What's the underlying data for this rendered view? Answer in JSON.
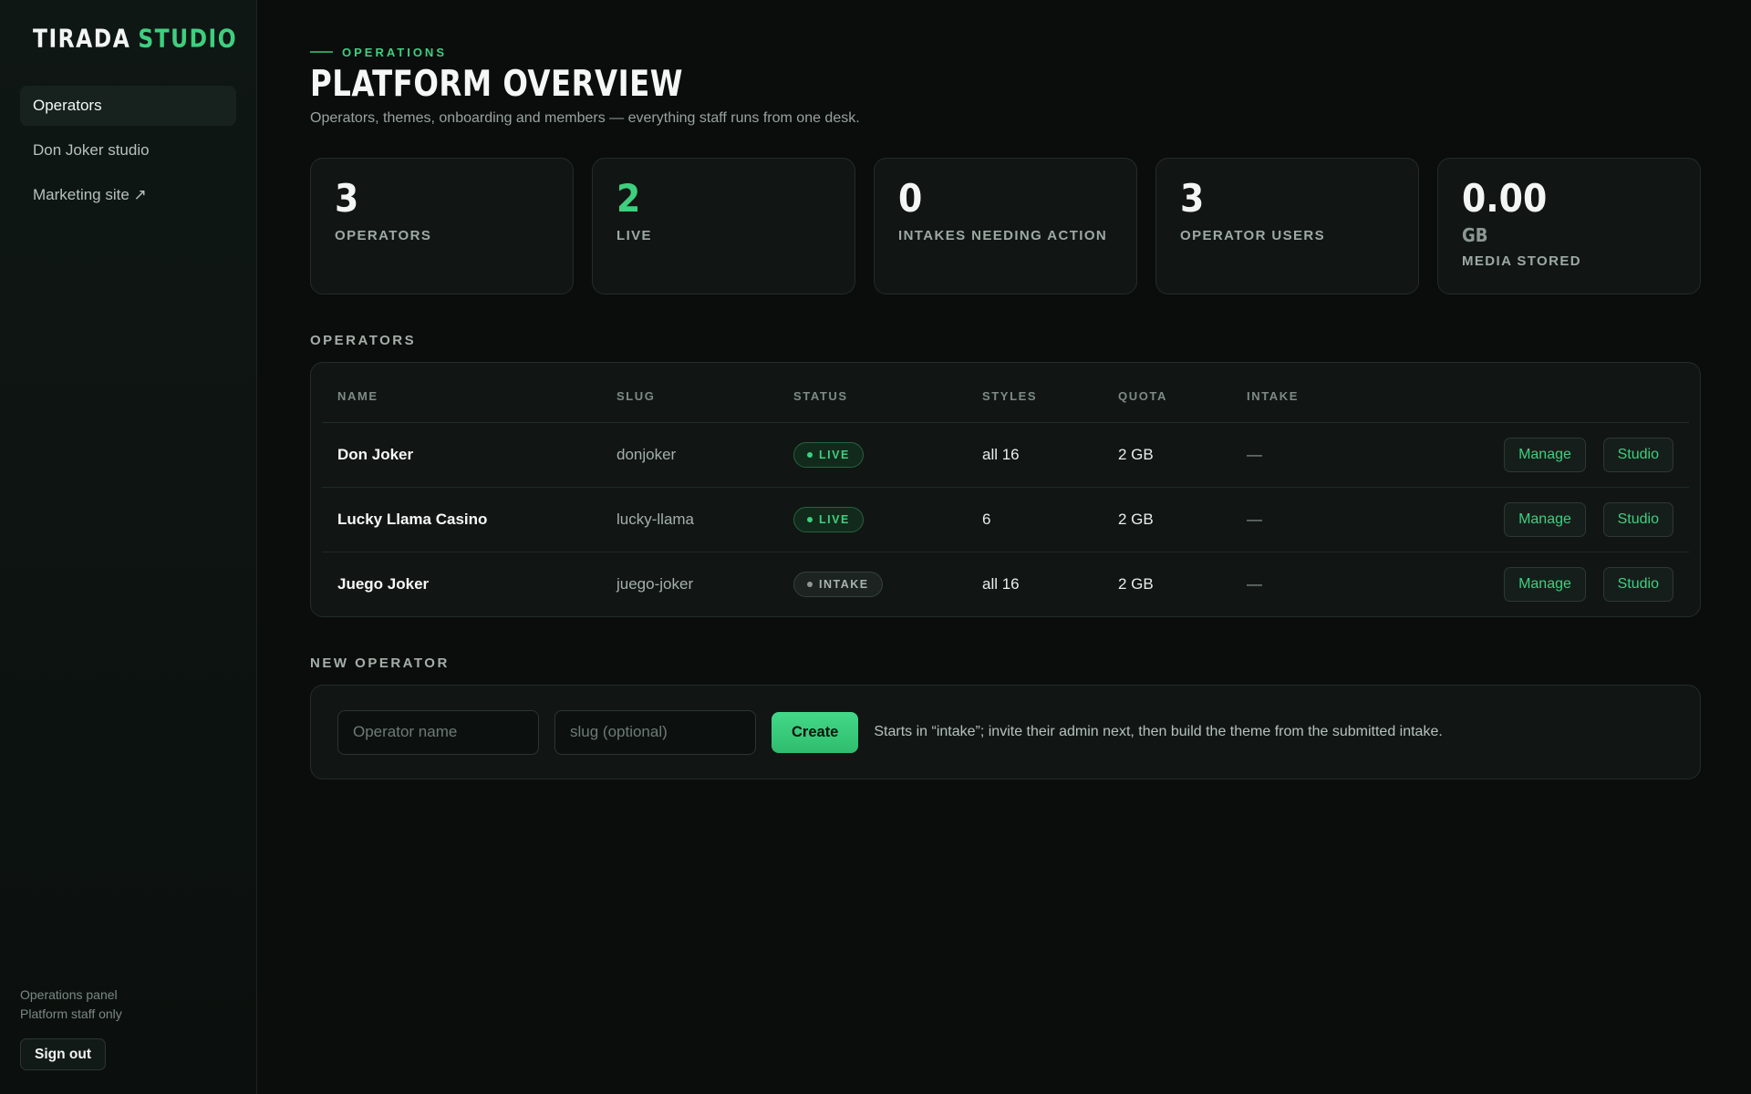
{
  "brand": {
    "name_primary": "TIRADA",
    "name_accent": "STUDIO",
    "accent_color": "#3ecf7f"
  },
  "sidebar": {
    "items": [
      {
        "label": "Operators",
        "active": true
      },
      {
        "label": "Don Joker studio",
        "active": false
      },
      {
        "label": "Marketing site ↗",
        "active": false
      }
    ],
    "footer_line1": "Operations panel",
    "footer_line2": "Platform staff only",
    "signout_label": "Sign out"
  },
  "header": {
    "eyebrow": "OPERATIONS",
    "title": "PLATFORM OVERVIEW",
    "subtitle": "Operators, themes, onboarding and members — everything staff runs from one desk."
  },
  "stats": [
    {
      "value": "3",
      "label": "OPERATORS"
    },
    {
      "value": "2",
      "label": "LIVE"
    },
    {
      "value": "0",
      "label": "INTAKES NEEDING ACTION"
    },
    {
      "value": "3",
      "label": "OPERATOR USERS"
    },
    {
      "value": "0.00",
      "unit": "GB",
      "label": "MEDIA STORED"
    }
  ],
  "operators_section": {
    "label": "OPERATORS",
    "columns": [
      "NAME",
      "SLUG",
      "STATUS",
      "STYLES",
      "QUOTA",
      "INTAKE"
    ],
    "rows": [
      {
        "name": "Don Joker",
        "slug": "donjoker",
        "status": "LIVE",
        "styles": "all 16",
        "quota": "2 GB",
        "intake": "—",
        "manage_label": "Manage",
        "studio_label": "Studio"
      },
      {
        "name": "Lucky Llama Casino",
        "slug": "lucky-llama",
        "status": "LIVE",
        "styles": "6",
        "quota": "2 GB",
        "intake": "—",
        "manage_label": "Manage",
        "studio_label": "Studio"
      },
      {
        "name": "Juego Joker",
        "slug": "juego-joker",
        "status": "INTAKE",
        "styles": "all 16",
        "quota": "2 GB",
        "intake": "—",
        "manage_label": "Manage",
        "studio_label": "Studio"
      }
    ]
  },
  "new_operator": {
    "label": "NEW OPERATOR",
    "name_value": "",
    "name_placeholder": "Operator name",
    "slug_value": "",
    "slug_placeholder": "slug (optional)",
    "create_label": "Create",
    "hint": "Starts in “intake”; invite their admin next, then build the theme from the submitted intake."
  }
}
